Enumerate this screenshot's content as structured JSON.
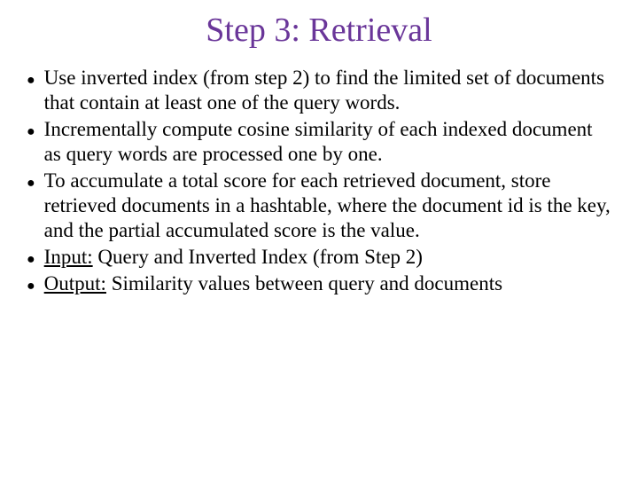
{
  "title": "Step 3: Retrieval",
  "bullets": [
    {
      "pre": "",
      "u": "",
      "post": "Use inverted index (from step 2) to find the limited set of documents that contain at least one of the query words."
    },
    {
      "pre": "",
      "u": "",
      "post": "Incrementally compute cosine similarity of each indexed document as query words are processed one by one."
    },
    {
      "pre": "",
      "u": "",
      "post": "To accumulate a total score for each retrieved document, store retrieved documents in a hashtable, where the document id is the key, and the partial accumulated score is the value."
    },
    {
      "pre": "",
      "u": "Input:",
      "post": " Query and Inverted Index (from Step 2)"
    },
    {
      "pre": "",
      "u": "Output:",
      "post": " Similarity values between query and documents"
    }
  ]
}
